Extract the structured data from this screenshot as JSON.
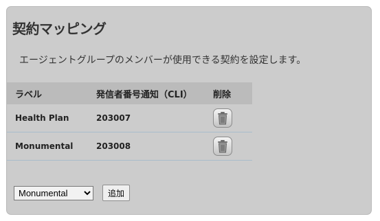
{
  "page": {
    "title": "契約マッピング",
    "description": "エージェントグループのメンバーが使用できる契約を設定します。"
  },
  "table": {
    "headers": {
      "label": "ラベル",
      "cli": "発信者番号通知（CLI）",
      "delete": "削除"
    },
    "rows": [
      {
        "label": "Health Plan",
        "cli": "203007"
      },
      {
        "label": "Monumental",
        "cli": "203008"
      }
    ]
  },
  "controls": {
    "selected": "Monumental",
    "add_label": "追加"
  },
  "icons": {
    "delete": "trash-icon"
  }
}
